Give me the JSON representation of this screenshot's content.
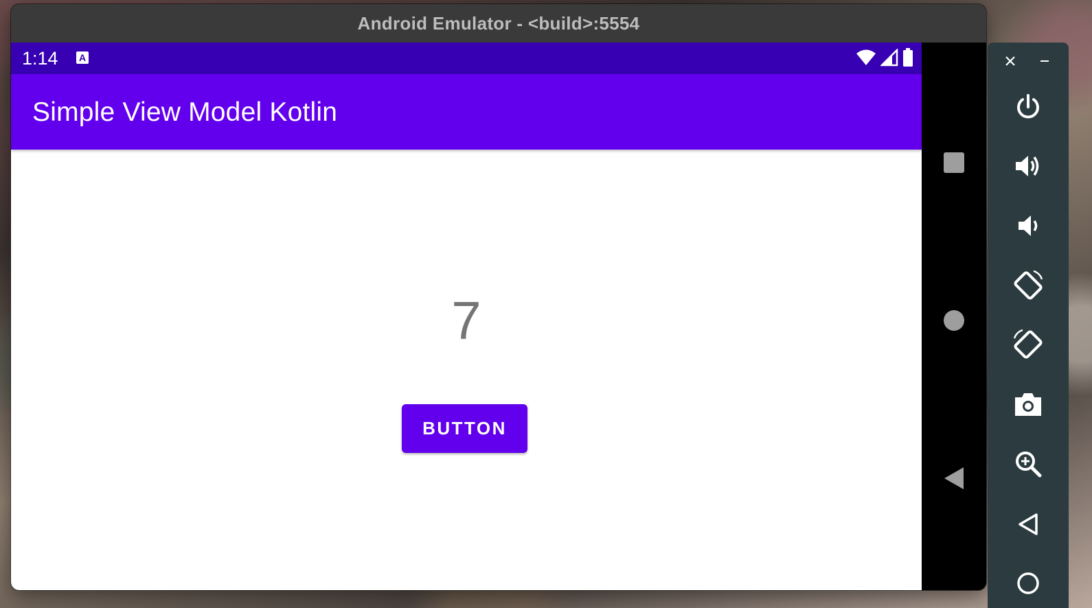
{
  "window": {
    "title": "Android Emulator - <build>:5554"
  },
  "status_bar": {
    "time": "1:14",
    "notification_icon": "a-keyboard-icon",
    "icons": [
      "wifi-icon",
      "signal-icon",
      "battery-icon"
    ]
  },
  "app_bar": {
    "title": "Simple View Model Kotlin"
  },
  "content": {
    "counter_value": "7",
    "button_label": "BUTTON"
  },
  "nav_bar": {
    "buttons": [
      "recents-square-icon",
      "home-circle-icon",
      "back-triangle-icon"
    ]
  },
  "toolbar": {
    "window_controls": [
      "close-icon",
      "minimize-icon"
    ],
    "tools": [
      "power-icon",
      "volume-up-icon",
      "volume-down-icon",
      "rotate-left-icon",
      "rotate-right-icon",
      "camera-icon",
      "zoom-icon",
      "back-icon",
      "home-icon"
    ]
  },
  "colors": {
    "status_bar": "#3700b3",
    "primary": "#6200ee",
    "toolbar_bg": "#2b3b3f",
    "title_bar_bg": "#3a3a3a"
  }
}
